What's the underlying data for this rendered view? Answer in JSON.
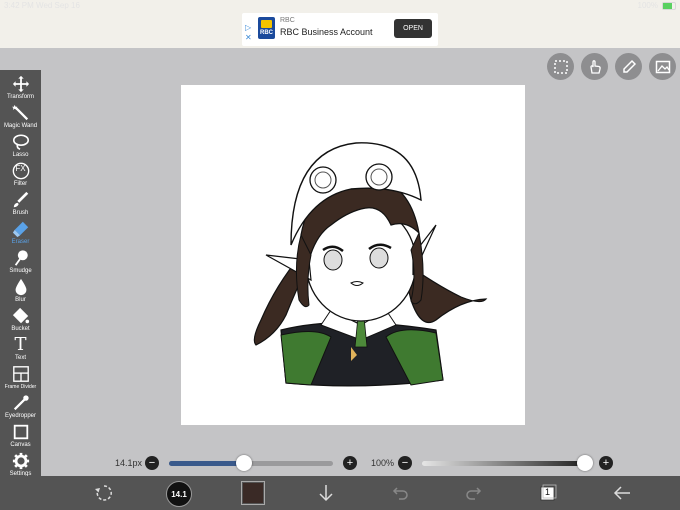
{
  "status": {
    "time": "3:42 PM",
    "date": "Wed Sep 16",
    "right": "100%"
  },
  "ad": {
    "brand": "RBC",
    "logo_text": "RBC",
    "title": "RBC Business Account",
    "cta": "OPEN"
  },
  "tools": [
    {
      "id": "transform",
      "label": "Transform",
      "icon": "move-arrows-icon"
    },
    {
      "id": "magic-wand",
      "label": "Magic Wand",
      "icon": "magic-wand-icon"
    },
    {
      "id": "lasso",
      "label": "Lasso",
      "icon": "lasso-icon"
    },
    {
      "id": "filter",
      "label": "Filter",
      "icon": "fx-icon",
      "glyph": "FX"
    },
    {
      "id": "brush",
      "label": "Brush",
      "icon": "brush-icon"
    },
    {
      "id": "eraser",
      "label": "Eraser",
      "icon": "eraser-icon",
      "active": true
    },
    {
      "id": "smudge",
      "label": "Smudge",
      "icon": "smudge-icon"
    },
    {
      "id": "blur",
      "label": "Blur",
      "icon": "drop-icon"
    },
    {
      "id": "bucket",
      "label": "Bucket",
      "icon": "bucket-icon"
    },
    {
      "id": "text",
      "label": "Text",
      "icon": "text-icon",
      "glyph": "T"
    },
    {
      "id": "frame-divider",
      "label": "Frame Divider",
      "icon": "frame-divider-icon"
    },
    {
      "id": "eyedropper",
      "label": "Eyedropper",
      "icon": "eyedropper-icon"
    },
    {
      "id": "canvas",
      "label": "Canvas",
      "icon": "canvas-icon"
    },
    {
      "id": "settings",
      "label": "Settings",
      "icon": "gear-icon"
    }
  ],
  "top_actions": [
    {
      "id": "selection",
      "icon": "selection-icon"
    },
    {
      "id": "hand",
      "icon": "hand-icon"
    },
    {
      "id": "pen",
      "icon": "pen-icon"
    },
    {
      "id": "layer-image",
      "icon": "image-icon"
    }
  ],
  "brush_size": {
    "value": "14.1px",
    "fraction": 0.46
  },
  "opacity": {
    "value": "100%",
    "fraction": 1.0
  },
  "bottom": {
    "brush_size_badge": "14.1",
    "color_swatch": "#3a2a26",
    "layer_count": "1"
  },
  "colors": {
    "toolbar_bg": "#545454",
    "accent": "#5aa2e8",
    "slider_fill": "#3a5a8c",
    "canvas_bg": "#ffffff"
  }
}
